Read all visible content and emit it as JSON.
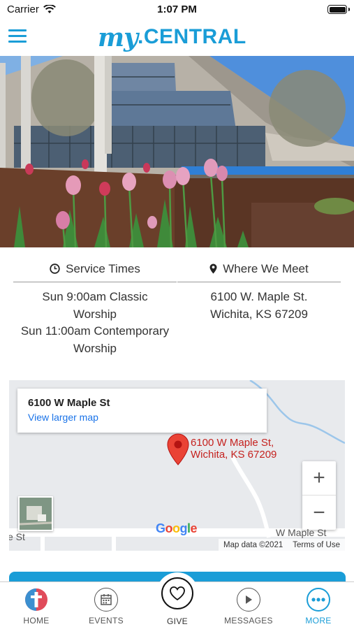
{
  "status_bar": {
    "carrier": "Carrier",
    "time": "1:07 PM"
  },
  "header": {
    "logo_script": "my",
    "logo_text": ".CENTRAL"
  },
  "info": {
    "service": {
      "heading": "Service Times",
      "lines": [
        "Sun 9:00am Classic",
        "Worship",
        "Sun 11:00am Contemporary",
        "Worship"
      ]
    },
    "location": {
      "heading": "Where We Meet",
      "lines": [
        "6100 W. Maple St.",
        "Wichita, KS 67209"
      ]
    }
  },
  "map": {
    "card_title": "6100 W Maple St",
    "card_link": "View larger map",
    "pin_label_line1": "6100 W Maple St,",
    "pin_label_line2": "Wichita, KS 67209",
    "zoom_in": "+",
    "zoom_out": "−",
    "street_right": "W Maple St",
    "street_left": "e St",
    "map_data": "Map data ©2021",
    "terms": "Terms of Use",
    "google_letters": [
      "G",
      "o",
      "o",
      "g",
      "l",
      "e"
    ],
    "google_colors": [
      "#4285f4",
      "#ea4335",
      "#fbbc05",
      "#4285f4",
      "#34a853",
      "#ea4335"
    ]
  },
  "tabs": [
    {
      "label": "HOME",
      "icon": "home-logo-icon"
    },
    {
      "label": "EVENTS",
      "icon": "calendar-icon"
    },
    {
      "label": "GIVE",
      "icon": "heart-icon"
    },
    {
      "label": "MESSAGES",
      "icon": "play-icon"
    },
    {
      "label": "MORE",
      "icon": "more-dots-icon"
    }
  ],
  "colors": {
    "brand": "#1a9dd7",
    "pin": "#c5221f",
    "link": "#1a73e8"
  }
}
